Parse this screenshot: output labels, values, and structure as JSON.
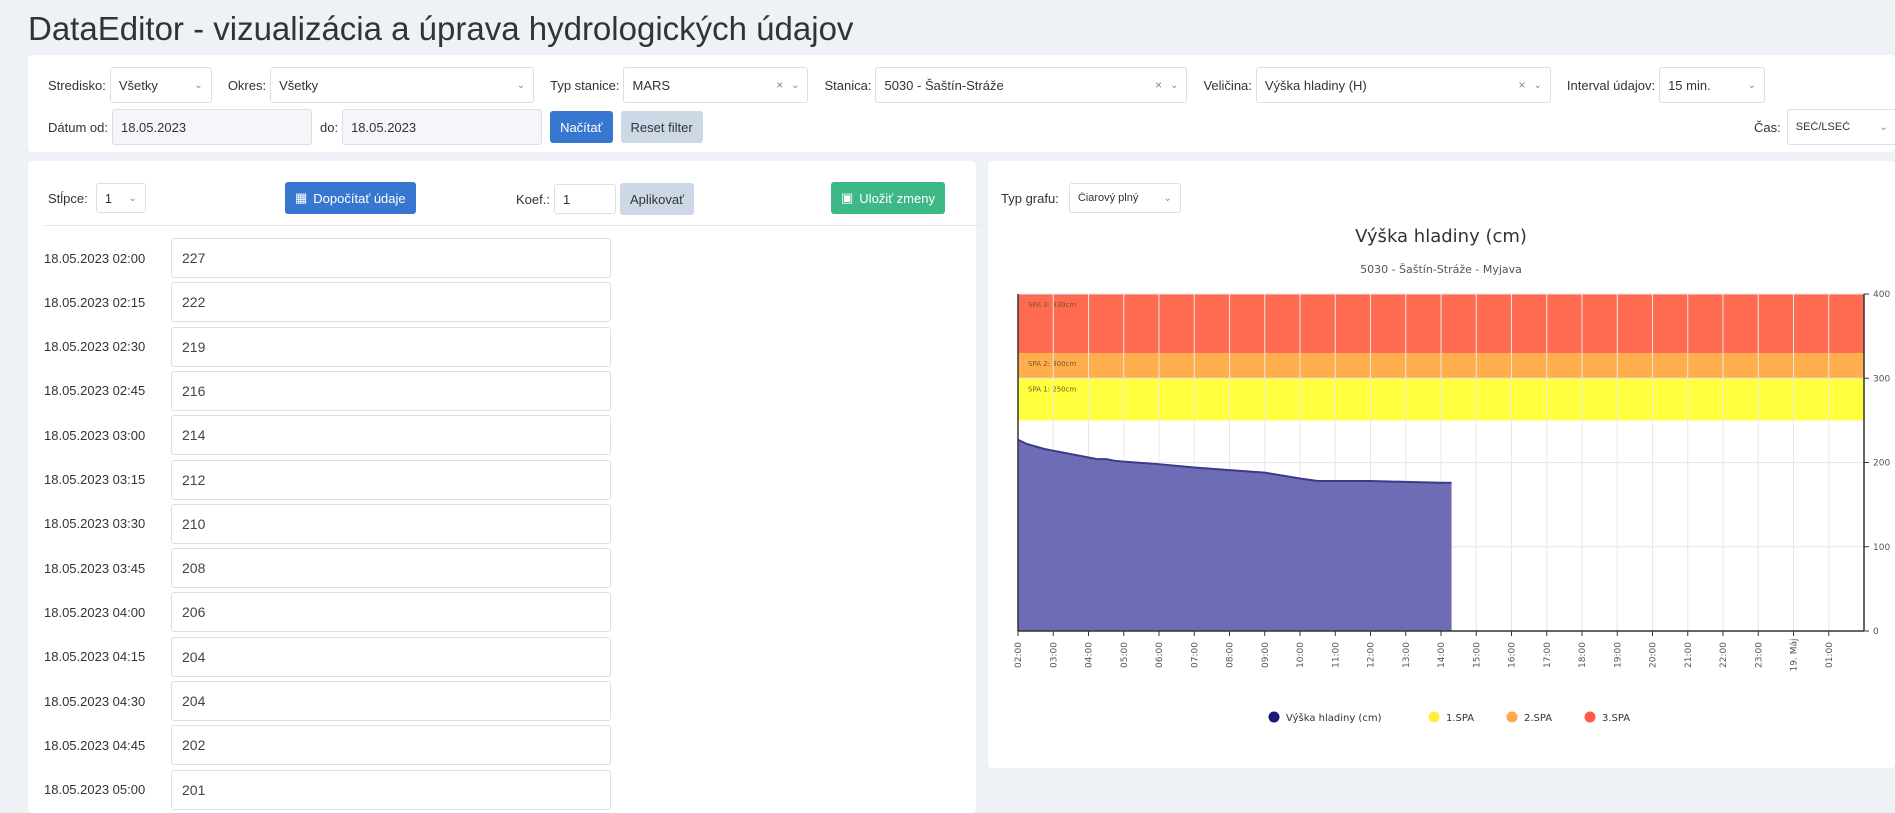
{
  "app": {
    "title": "DataEditor - vizualizácia a úprava hydrologických údajov"
  },
  "filters": {
    "stredisko": {
      "label": "Stredisko:",
      "value": "Všetky"
    },
    "okres": {
      "label": "Okres:",
      "value": "Všetky"
    },
    "typ_stanice": {
      "label": "Typ stanice:",
      "value": "MARS"
    },
    "stanica": {
      "label": "Stanica:",
      "value": "5030 - Šaštín-Stráže"
    },
    "velicina": {
      "label": "Veličina:",
      "value": "Výška hladiny (H)"
    },
    "interval": {
      "label": "Interval údajov:",
      "value": "15 min."
    },
    "datum_od": {
      "label": "Dátum od:",
      "value": "18.05.2023"
    },
    "datum_do": {
      "label": "do:",
      "value": "18.05.2023"
    },
    "nacitat": "Načítať",
    "reset": "Reset filter",
    "cas": {
      "label": "Čas:",
      "value": "SEČ/LSEČ"
    }
  },
  "editor": {
    "stlpce": {
      "label": "Stĺpce:",
      "value": "1"
    },
    "dopocitat": "Dopočítať údaje",
    "koef": {
      "label": "Koef.:",
      "value": "1"
    },
    "aplikovat": "Aplikovať",
    "ulozit": "Uložiť zmeny",
    "rows": [
      {
        "time": "18.05.2023 02:00",
        "value": "227"
      },
      {
        "time": "18.05.2023 02:15",
        "value": "222"
      },
      {
        "time": "18.05.2023 02:30",
        "value": "219"
      },
      {
        "time": "18.05.2023 02:45",
        "value": "216"
      },
      {
        "time": "18.05.2023 03:00",
        "value": "214"
      },
      {
        "time": "18.05.2023 03:15",
        "value": "212"
      },
      {
        "time": "18.05.2023 03:30",
        "value": "210"
      },
      {
        "time": "18.05.2023 03:45",
        "value": "208"
      },
      {
        "time": "18.05.2023 04:00",
        "value": "206"
      },
      {
        "time": "18.05.2023 04:15",
        "value": "204"
      },
      {
        "time": "18.05.2023 04:30",
        "value": "204"
      },
      {
        "time": "18.05.2023 04:45",
        "value": "202"
      },
      {
        "time": "18.05.2023 05:00",
        "value": "201"
      }
    ]
  },
  "chart_panel": {
    "typ_grafu": {
      "label": "Typ grafu:",
      "value": "Čiarový plný"
    }
  },
  "chart_data": {
    "type": "area",
    "title": "Výška hladiny (cm)",
    "subtitle": "5030 - Šaštín-Stráže - Myjava",
    "ylim": [
      0,
      400
    ],
    "yticks": [
      0,
      100,
      200,
      300,
      400
    ],
    "ytick_labels": [
      "0",
      "100",
      "200",
      "300",
      "400"
    ],
    "x_tick_labels": [
      "02:00",
      "03:00",
      "04:00",
      "05:00",
      "06:00",
      "07:00",
      "08:00",
      "09:00",
      "10:00",
      "11:00",
      "12:00",
      "13:00",
      "14:00",
      "15:00",
      "16:00",
      "17:00",
      "18:00",
      "19:00",
      "20:00",
      "21:00",
      "22:00",
      "23:00",
      "19. Máj",
      "01:00"
    ],
    "x_range_hours": [
      2,
      26
    ],
    "series": [
      {
        "name": "Výška hladiny (cm)",
        "color": "#6e6cb5",
        "x": [
          2.0,
          2.25,
          2.5,
          2.75,
          3.0,
          3.25,
          3.5,
          3.75,
          4.0,
          4.25,
          4.5,
          4.75,
          5.0,
          6.0,
          7.0,
          8.0,
          9.0,
          10.0,
          10.5,
          11.0,
          12.0,
          13.0,
          14.0,
          14.3
        ],
        "values": [
          227,
          222,
          219,
          216,
          214,
          212,
          210,
          208,
          206,
          204,
          204,
          202,
          201,
          198,
          194,
          191,
          188,
          181,
          178,
          178,
          178,
          177,
          176,
          176
        ]
      }
    ],
    "bands": [
      {
        "name": "1.SPA",
        "from": 250,
        "to": 300,
        "color": "#ffff33",
        "label": "SPA 1: 250cm"
      },
      {
        "name": "2.SPA",
        "from": 300,
        "to": 330,
        "color": "#ffaa44",
        "label": "SPA 2: 300cm"
      },
      {
        "name": "3.SPA",
        "from": 330,
        "to": 400,
        "color": "#ff6347",
        "label": "SPA 3: 330cm"
      }
    ],
    "legend": [
      {
        "name": "Výška hladiny (cm)",
        "color": "#1a1a7a"
      },
      {
        "name": "1.SPA",
        "color": "#ffef3a"
      },
      {
        "name": "2.SPA",
        "color": "#ffa94a"
      },
      {
        "name": "3.SPA",
        "color": "#ff5a4a"
      }
    ],
    "legend_position": "bottom",
    "grid": true
  }
}
